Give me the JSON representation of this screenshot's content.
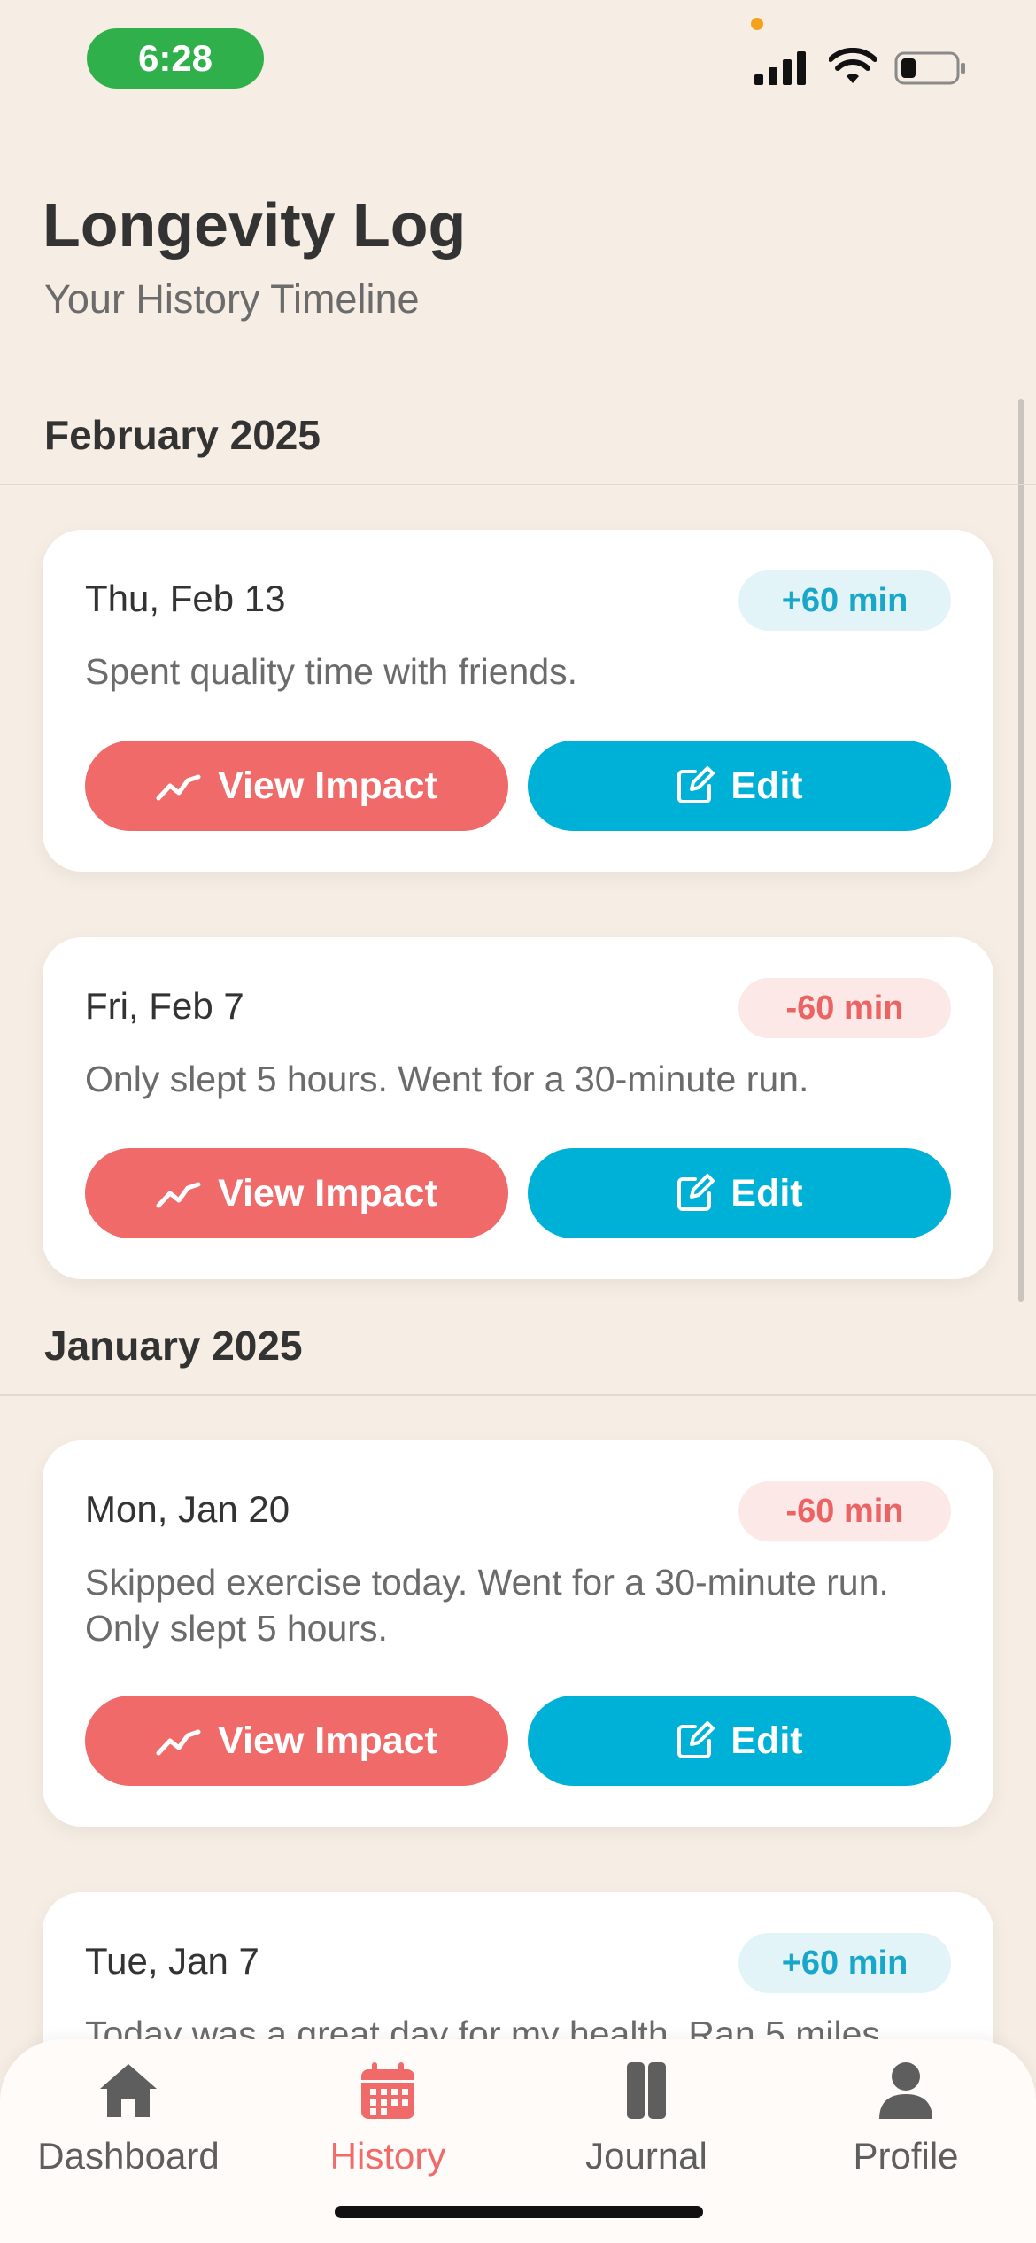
{
  "status_bar": {
    "time": "6:28"
  },
  "header": {
    "title": "Longevity Log",
    "subtitle": "Your History Timeline"
  },
  "sections": [
    {
      "month": "February 2025",
      "entries": [
        {
          "date": "Thu, Feb 13",
          "delta": "+60 min",
          "delta_type": "positive",
          "note": "Spent quality time with friends."
        },
        {
          "date": "Fri, Feb 7",
          "delta": "-60 min",
          "delta_type": "negative",
          "note": "Only slept 5 hours. Went for a 30-minute run."
        }
      ]
    },
    {
      "month": "January 2025",
      "entries": [
        {
          "date": "Mon, Jan 20",
          "delta": "-60 min",
          "delta_type": "negative",
          "note": "Skipped exercise today. Went for a 30-minute run. Only slept 5 hours."
        },
        {
          "date": "Tue, Jan 7",
          "delta": "+60 min",
          "delta_type": "positive",
          "note": "Today was a great day for my health. Ran 5 miles"
        }
      ]
    }
  ],
  "actions": {
    "view_impact_label": "View Impact",
    "edit_label": "Edit"
  },
  "bottom_nav": [
    {
      "label": "Dashboard",
      "icon": "home-icon",
      "active": false
    },
    {
      "label": "History",
      "icon": "calendar-icon",
      "active": true
    },
    {
      "label": "Journal",
      "icon": "book-icon",
      "active": false
    },
    {
      "label": "Profile",
      "icon": "person-icon",
      "active": false
    }
  ],
  "colors": {
    "background": "#f6ede4",
    "primary_red": "#f06a6a",
    "primary_cyan": "#00b1d7",
    "positive_badge_text": "#19a7c9",
    "negative_badge_text": "#ec6363"
  }
}
